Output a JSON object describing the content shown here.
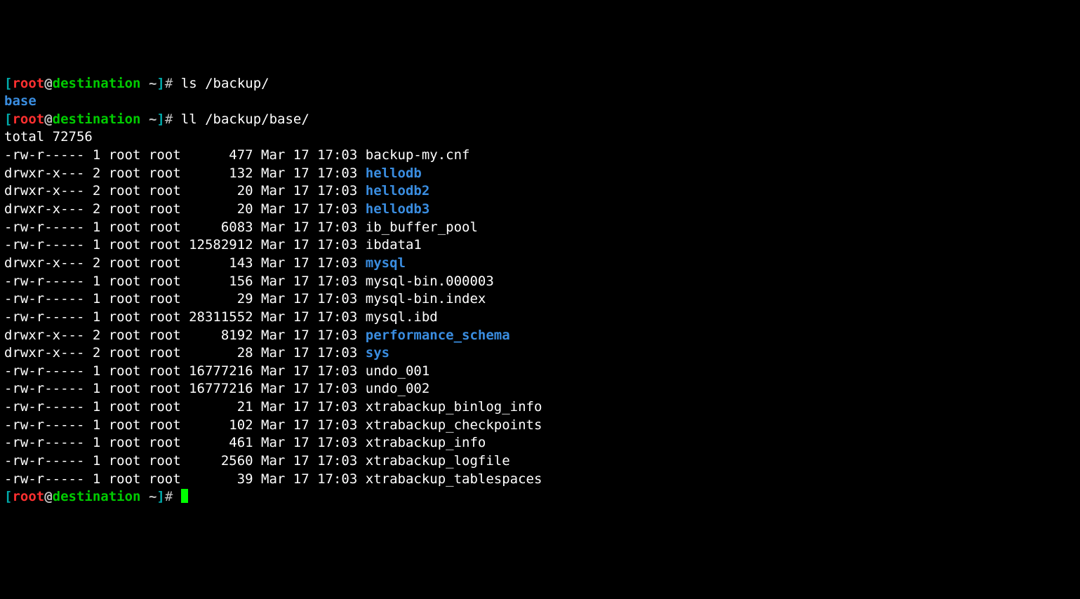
{
  "prompt": {
    "user": "root",
    "at": "@",
    "host": "destination",
    "path": "~",
    "hash": "#"
  },
  "cmd1": "ls /backup/",
  "ls_output": "base",
  "cmd2": "ll /backup/base/",
  "total_line": "total 72756",
  "entries": [
    {
      "perms": "-rw-r-----",
      "links": "1",
      "owner": "root",
      "group": "root",
      "size": "477",
      "date": "Mar 17 17:03",
      "name": "backup-my.cnf",
      "is_dir": false
    },
    {
      "perms": "drwxr-x---",
      "links": "2",
      "owner": "root",
      "group": "root",
      "size": "132",
      "date": "Mar 17 17:03",
      "name": "hellodb",
      "is_dir": true
    },
    {
      "perms": "drwxr-x---",
      "links": "2",
      "owner": "root",
      "group": "root",
      "size": "20",
      "date": "Mar 17 17:03",
      "name": "hellodb2",
      "is_dir": true
    },
    {
      "perms": "drwxr-x---",
      "links": "2",
      "owner": "root",
      "group": "root",
      "size": "20",
      "date": "Mar 17 17:03",
      "name": "hellodb3",
      "is_dir": true
    },
    {
      "perms": "-rw-r-----",
      "links": "1",
      "owner": "root",
      "group": "root",
      "size": "6083",
      "date": "Mar 17 17:03",
      "name": "ib_buffer_pool",
      "is_dir": false
    },
    {
      "perms": "-rw-r-----",
      "links": "1",
      "owner": "root",
      "group": "root",
      "size": "12582912",
      "date": "Mar 17 17:03",
      "name": "ibdata1",
      "is_dir": false
    },
    {
      "perms": "drwxr-x---",
      "links": "2",
      "owner": "root",
      "group": "root",
      "size": "143",
      "date": "Mar 17 17:03",
      "name": "mysql",
      "is_dir": true
    },
    {
      "perms": "-rw-r-----",
      "links": "1",
      "owner": "root",
      "group": "root",
      "size": "156",
      "date": "Mar 17 17:03",
      "name": "mysql-bin.000003",
      "is_dir": false
    },
    {
      "perms": "-rw-r-----",
      "links": "1",
      "owner": "root",
      "group": "root",
      "size": "29",
      "date": "Mar 17 17:03",
      "name": "mysql-bin.index",
      "is_dir": false
    },
    {
      "perms": "-rw-r-----",
      "links": "1",
      "owner": "root",
      "group": "root",
      "size": "28311552",
      "date": "Mar 17 17:03",
      "name": "mysql.ibd",
      "is_dir": false
    },
    {
      "perms": "drwxr-x---",
      "links": "2",
      "owner": "root",
      "group": "root",
      "size": "8192",
      "date": "Mar 17 17:03",
      "name": "performance_schema",
      "is_dir": true
    },
    {
      "perms": "drwxr-x---",
      "links": "2",
      "owner": "root",
      "group": "root",
      "size": "28",
      "date": "Mar 17 17:03",
      "name": "sys",
      "is_dir": true
    },
    {
      "perms": "-rw-r-----",
      "links": "1",
      "owner": "root",
      "group": "root",
      "size": "16777216",
      "date": "Mar 17 17:03",
      "name": "undo_001",
      "is_dir": false
    },
    {
      "perms": "-rw-r-----",
      "links": "1",
      "owner": "root",
      "group": "root",
      "size": "16777216",
      "date": "Mar 17 17:03",
      "name": "undo_002",
      "is_dir": false
    },
    {
      "perms": "-rw-r-----",
      "links": "1",
      "owner": "root",
      "group": "root",
      "size": "21",
      "date": "Mar 17 17:03",
      "name": "xtrabackup_binlog_info",
      "is_dir": false
    },
    {
      "perms": "-rw-r-----",
      "links": "1",
      "owner": "root",
      "group": "root",
      "size": "102",
      "date": "Mar 17 17:03",
      "name": "xtrabackup_checkpoints",
      "is_dir": false
    },
    {
      "perms": "-rw-r-----",
      "links": "1",
      "owner": "root",
      "group": "root",
      "size": "461",
      "date": "Mar 17 17:03",
      "name": "xtrabackup_info",
      "is_dir": false
    },
    {
      "perms": "-rw-r-----",
      "links": "1",
      "owner": "root",
      "group": "root",
      "size": "2560",
      "date": "Mar 17 17:03",
      "name": "xtrabackup_logfile",
      "is_dir": false
    },
    {
      "perms": "-rw-r-----",
      "links": "1",
      "owner": "root",
      "group": "root",
      "size": "39",
      "date": "Mar 17 17:03",
      "name": "xtrabackup_tablespaces",
      "is_dir": false
    }
  ]
}
